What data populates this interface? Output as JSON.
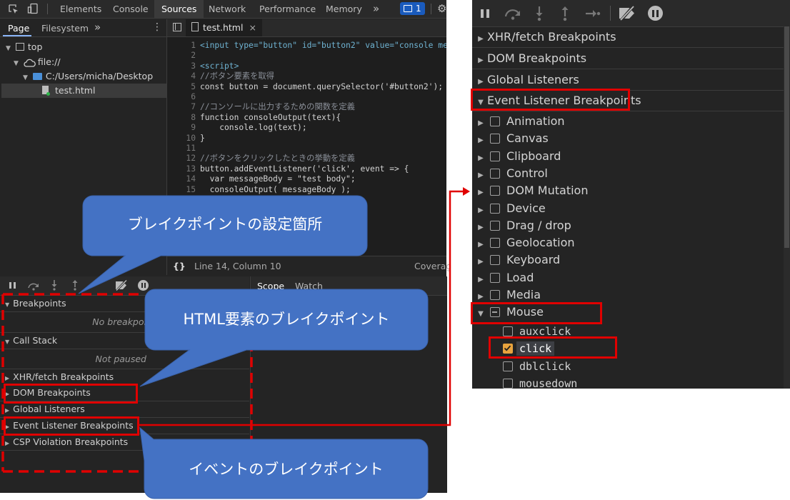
{
  "toolbar": {
    "tabs": [
      "Elements",
      "Console",
      "Sources",
      "Network",
      "Performance",
      "Memory"
    ],
    "more": "»",
    "badge": "1"
  },
  "navigator": {
    "tabs": [
      "Page",
      "Filesystem"
    ],
    "more": "»",
    "tree": [
      "top",
      "file://",
      "C:/Users/micha/Desktop",
      "test.html"
    ]
  },
  "editor": {
    "file_tab": "test.html",
    "lines": [
      {
        "n": "1",
        "text": "<input type=\"button\" id=\"button2\" value=\"console me"
      },
      {
        "n": "2",
        "text": ""
      },
      {
        "n": "3",
        "text": "<script>"
      },
      {
        "n": "4",
        "text": "//ボタン要素を取得"
      },
      {
        "n": "5",
        "text": "const button = document.querySelector('#button2');"
      },
      {
        "n": "6",
        "text": ""
      },
      {
        "n": "7",
        "text": "//コンソールに出力するための関数を定義"
      },
      {
        "n": "8",
        "text": "function consoleOutput(text){"
      },
      {
        "n": "9",
        "text": "    console.log(text);"
      },
      {
        "n": "10",
        "text": "}"
      },
      {
        "n": "11",
        "text": ""
      },
      {
        "n": "12",
        "text": "//ボタンをクリックしたときの挙動を定義"
      },
      {
        "n": "13",
        "text": "button.addEventListener('click', event => {"
      },
      {
        "n": "14",
        "text": "  var messageBody = \"test body\";"
      },
      {
        "n": "15",
        "text": "  consoleOutput( messageBody );"
      }
    ],
    "status_braces": "{}",
    "status_position": "Line 14, Column 10",
    "status_coverage": "Coverag"
  },
  "debugger": {
    "scope_tab": "Scope",
    "watch_tab": "Watch",
    "sections": {
      "breakpoints": "Breakpoints",
      "breakpoints_empty": "No breakpoi",
      "call_stack": "Call Stack",
      "not_paused": "Not paused",
      "xhr": "XHR/fetch Breakpoints",
      "dom": "DOM Breakpoints",
      "global": "Global Listeners",
      "event": "Event Listener Breakpoints",
      "csp": "CSP Violation Breakpoints"
    }
  },
  "right_panel": {
    "sections": [
      "XHR/fetch Breakpoints",
      "DOM Breakpoints",
      "Global Listeners",
      "Event Listener Breakpoints"
    ],
    "categories": [
      "Animation",
      "Canvas",
      "Clipboard",
      "Control",
      "DOM Mutation",
      "Device",
      "Drag / drop",
      "Geolocation",
      "Keyboard",
      "Load",
      "Media",
      "Mouse"
    ],
    "mouse_events": [
      {
        "name": "auxclick",
        "checked": false
      },
      {
        "name": "click",
        "checked": true
      },
      {
        "name": "dblclick",
        "checked": false
      },
      {
        "name": "mousedown",
        "checked": false
      }
    ]
  },
  "callouts": {
    "setting_location": "ブレイクポイントの設定箇所",
    "html_element": "HTML要素のブレイクポイント",
    "event": "イベントのブレイクポイント"
  },
  "colors": {
    "callout_fill": "#4472c4",
    "highlight_red": "#e00000",
    "checkbox_orange": "#e8a33d",
    "panel_bg": "#242424"
  }
}
